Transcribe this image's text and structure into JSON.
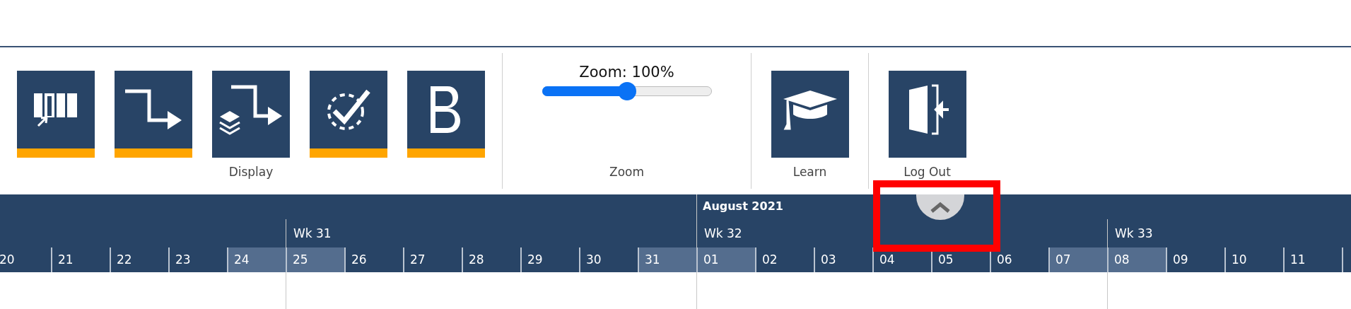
{
  "ribbon": {
    "groups": [
      {
        "label": "Display",
        "buttons": [
          {
            "kind": "columns",
            "active": true
          },
          {
            "kind": "route",
            "active": true
          },
          {
            "kind": "layers-route",
            "active": false
          },
          {
            "kind": "check",
            "active": true
          },
          {
            "kind": "bold",
            "active": true
          }
        ]
      },
      {
        "label": "Zoom",
        "slider": {
          "label": "Zoom: 100%",
          "level": 0.5
        }
      },
      {
        "label": "Learn",
        "buttons": [
          {
            "kind": "graduation",
            "active": false
          }
        ]
      },
      {
        "label": "Log Out",
        "buttons": [
          {
            "kind": "exit",
            "active": false
          }
        ]
      }
    ]
  },
  "timeline": {
    "months": [
      {
        "weeks": [
          {
            "days": [
              {
                "label": "20",
                "weekend": false
              },
              {
                "label": "21",
                "weekend": false
              },
              {
                "label": "22",
                "weekend": false
              },
              {
                "label": "23",
                "weekend": false
              },
              {
                "label": "24",
                "weekend": true
              }
            ]
          },
          {
            "label": "Wk 31",
            "days": [
              {
                "label": "25",
                "weekend": true
              },
              {
                "label": "26",
                "weekend": false
              },
              {
                "label": "27",
                "weekend": false
              },
              {
                "label": "28",
                "weekend": false
              },
              {
                "label": "29",
                "weekend": false
              },
              {
                "label": "30",
                "weekend": false
              },
              {
                "label": "31",
                "weekend": true
              }
            ]
          }
        ]
      },
      {
        "label": "August 2021",
        "weeks": [
          {
            "label": "Wk 32",
            "days": [
              {
                "label": "01",
                "weekend": true
              },
              {
                "label": "02",
                "weekend": false
              },
              {
                "label": "03",
                "weekend": false
              },
              {
                "label": "04",
                "weekend": false
              },
              {
                "label": "05",
                "weekend": false
              },
              {
                "label": "06",
                "weekend": false
              },
              {
                "label": "07",
                "weekend": true
              }
            ]
          },
          {
            "label": "Wk 33",
            "days": [
              {
                "label": "08",
                "weekend": true
              },
              {
                "label": "09",
                "weekend": false
              },
              {
                "label": "10",
                "weekend": false
              },
              {
                "label": "11",
                "weekend": false
              }
            ]
          }
        ]
      }
    ]
  }
}
